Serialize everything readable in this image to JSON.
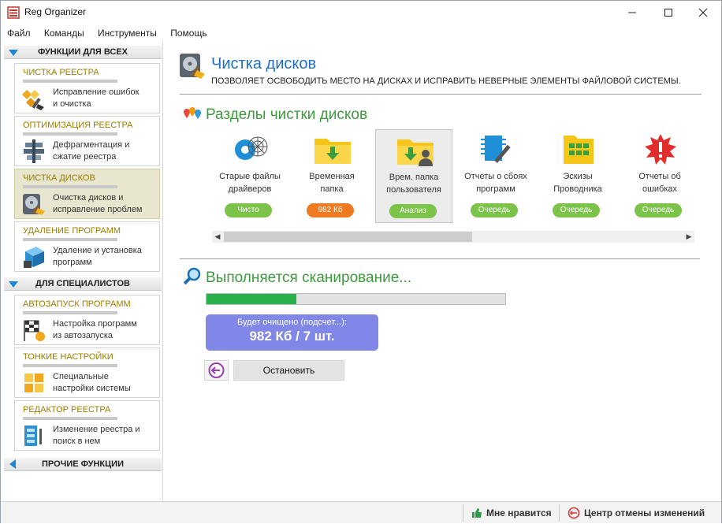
{
  "window": {
    "title": "Reg Organizer"
  },
  "menu": [
    "Файл",
    "Команды",
    "Инструменты",
    "Помощь"
  ],
  "sidebar": {
    "sections": [
      {
        "label": "ФУНКЦИИ ДЛЯ ВСЕХ"
      },
      {
        "label": "ДЛЯ СПЕЦИАЛИСТОВ"
      },
      {
        "label": "ПРОЧИЕ ФУНКЦИИ"
      }
    ],
    "cards": [
      {
        "title": "ЧИСТКА РЕЕСТРА",
        "desc1": "Исправление ошибок",
        "desc2": "и очистка",
        "icon": "registry-clean-icon"
      },
      {
        "title": "ОПТИМИЗАЦИЯ РЕЕСТРА",
        "desc1": "Дефрагментация и",
        "desc2": "сжатие реестра",
        "icon": "registry-optimize-icon"
      },
      {
        "title": "ЧИСТКА ДИСКОВ",
        "desc1": "Очистка дисков и",
        "desc2": "исправление проблем",
        "icon": "disk-clean-icon",
        "active": true
      },
      {
        "title": "УДАЛЕНИЕ ПРОГРАММ",
        "desc1": "Удаление и установка",
        "desc2": "программ",
        "icon": "uninstall-icon"
      },
      {
        "title": "АВТОЗАПУСК ПРОГРАММ",
        "desc1": "Настройка программ",
        "desc2": "из автозапуска",
        "icon": "autorun-icon"
      },
      {
        "title": "ТОНКИЕ НАСТРОЙКИ",
        "desc1": "Специальные",
        "desc2": "настройки системы",
        "icon": "tweaks-icon"
      },
      {
        "title": "РЕДАКТОР РЕЕСТРА",
        "desc1": "Изменение реестра и",
        "desc2": "поиск в нем",
        "icon": "registry-editor-icon"
      }
    ]
  },
  "main": {
    "title": "Чистка дисков",
    "subtitle": "ПОЗВОЛЯЕТ ОСВОБОДИТЬ МЕСТО НА ДИСКАХ И ИСПРАВИТЬ НЕВЕРНЫЕ ЭЛЕМЕНТЫ ФАЙЛОВОЙ СИСТЕМЫ.",
    "sections_title": "Разделы чистки дисков",
    "tiles": [
      {
        "line1": "Старые файлы",
        "line2": "драйверов",
        "status": "Чисто",
        "icon": "driver-files-icon",
        "badge_color": "#7cc34a"
      },
      {
        "line1": "Временная",
        "line2": "папка",
        "status": "982 Кб",
        "icon": "temp-folder-icon",
        "badge_color": "#f07a22"
      },
      {
        "line1": "Врем. папка",
        "line2": "пользователя",
        "status": "Анализ",
        "icon": "user-temp-folder-icon",
        "badge_color": "#7cc34a",
        "selected": true
      },
      {
        "line1": "Отчеты о сбоях",
        "line2": "программ",
        "status": "Очередь",
        "icon": "crash-reports-icon",
        "badge_color": "#7cc34a"
      },
      {
        "line1": "Эскизы",
        "line2": "Проводника",
        "status": "Очередь",
        "icon": "thumbnails-icon",
        "badge_color": "#7cc34a"
      },
      {
        "line1": "Отчеты об",
        "line2": "ошибках",
        "status": "Очередь",
        "icon": "error-reports-icon",
        "badge_color": "#7cc34a"
      }
    ],
    "scan_title": "Выполняется сканирование...",
    "progress": 0.3,
    "result_label": "Будет очищено (подсчет...):",
    "result_value": "982 Кб / 7 шт.",
    "stop_label": "Остановить"
  },
  "statusbar": {
    "like_label": "Мне нравится",
    "undo_label": "Центр отмены изменений"
  },
  "colors": {
    "accent": "#1e6fbf",
    "green": "#3d9a3d",
    "progress": "#28b14c",
    "result_bg": "#8087e6"
  }
}
